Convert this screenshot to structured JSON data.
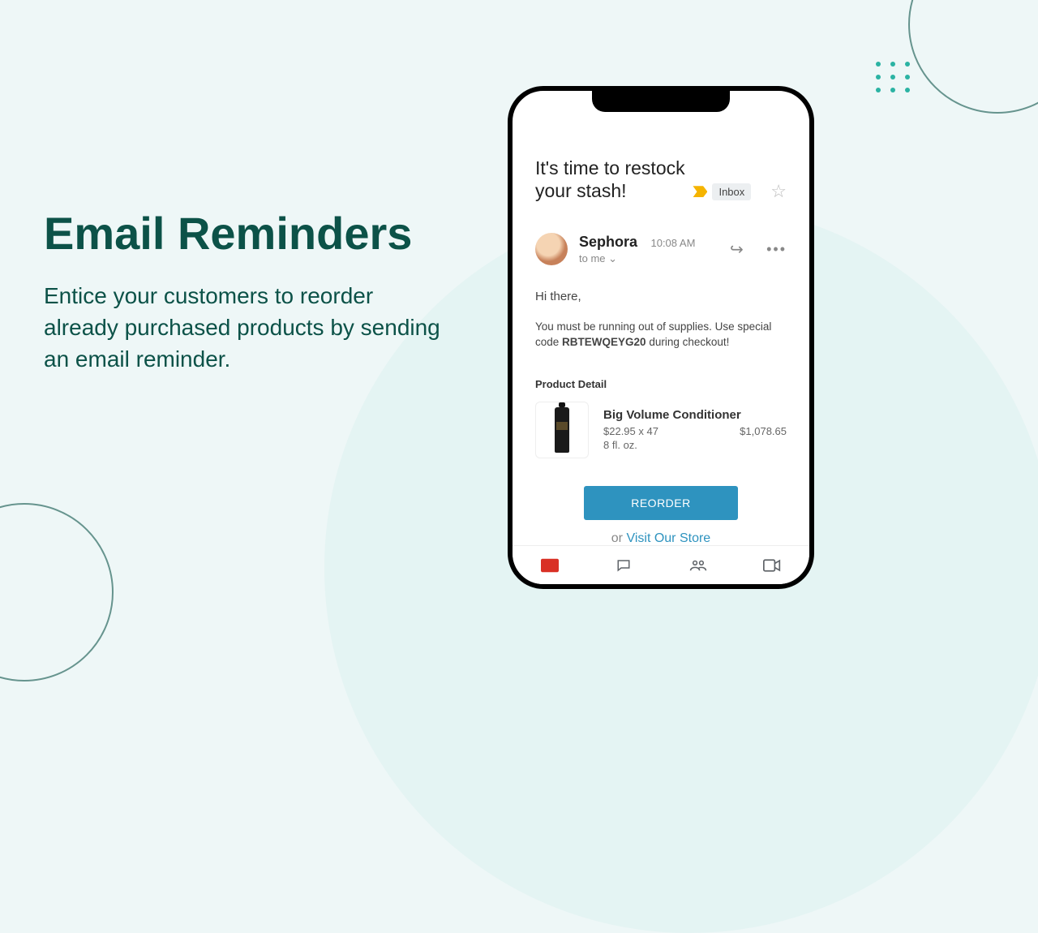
{
  "hero": {
    "title": "Email Reminders",
    "subtitle": "Entice your customers to reorder already purchased products by sending an email reminder."
  },
  "email": {
    "subject": "It's time to restock your stash!",
    "inbox_label": "Inbox",
    "sender": "Sephora",
    "time": "10:08 AM",
    "to_line": "to me",
    "greeting": "Hi there,",
    "body_pre": "You must be running out of supplies. Use special code ",
    "code": "RBTEWQEYG20",
    "body_post": " during checkout!",
    "product_detail_label": "Product Detail",
    "product": {
      "name": "Big Volume Conditioner",
      "unit_price": "$22.95 x 47",
      "total": "$1,078.65",
      "size": "8 fl. oz."
    },
    "reorder_label": "REORDER",
    "or_text": "or ",
    "visit_link": "Visit Our Store"
  }
}
